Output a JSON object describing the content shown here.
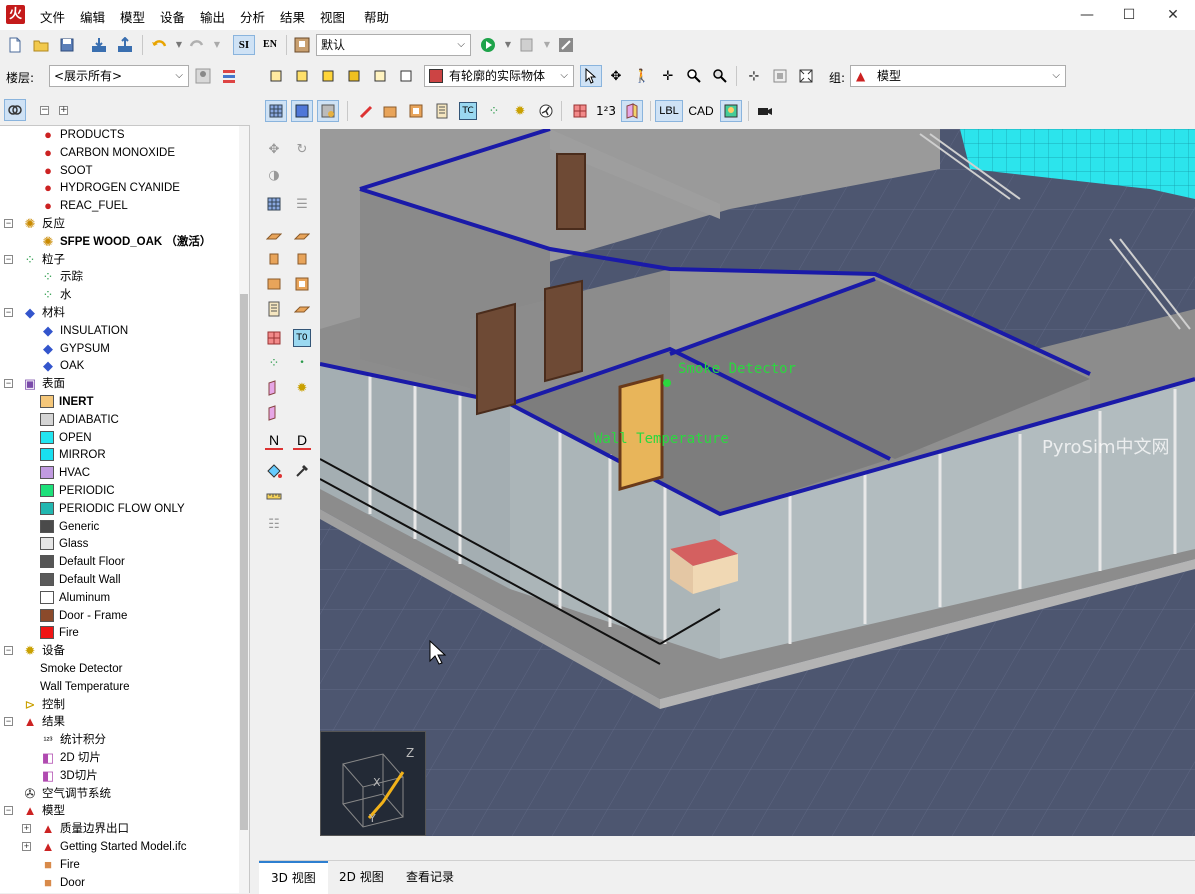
{
  "app": {
    "logo_glyph": "火",
    "accent": "#c41a1a"
  },
  "menu": [
    "文件",
    "编辑",
    "模型",
    "设备",
    "输出",
    "分析",
    "结果",
    "视图",
    "帮助"
  ],
  "window_controls": {
    "minimize": "—",
    "maximize": "☐",
    "close": "✕"
  },
  "toolbar1": {
    "units_si": "SI",
    "units_en": "EN",
    "view_combo": "默认"
  },
  "toolbar2": {
    "floor_label": "楼层:",
    "floor_combo": "<展示所有>",
    "filter_combo": "有轮廓的实际物体",
    "group_label": "组:",
    "group_combo": "模型"
  },
  "toolbar3": {
    "lbl_button": "LBL",
    "cad_button": "CAD"
  },
  "vstrip": {
    "n_button": "N",
    "d_button": "D"
  },
  "tree": {
    "rows": [
      {
        "label": "PRODUCTS",
        "indent": 2,
        "icon": "species",
        "bold": false
      },
      {
        "label": "CARBON MONOXIDE",
        "indent": 2,
        "icon": "species",
        "bold": false
      },
      {
        "label": "SOOT",
        "indent": 2,
        "icon": "species",
        "bold": false
      },
      {
        "label": "HYDROGEN CYANIDE",
        "indent": 2,
        "icon": "species",
        "bold": false
      },
      {
        "label": "REAC_FUEL",
        "indent": 2,
        "icon": "species",
        "bold": false
      },
      {
        "label": "反应",
        "indent": 1,
        "icon": "reaction",
        "expander": "−",
        "bold": false
      },
      {
        "label": "SFPE WOOD_OAK （激活）",
        "indent": 2,
        "icon": "reaction",
        "bold": true
      },
      {
        "label": "粒子",
        "indent": 1,
        "icon": "particle",
        "expander": "−",
        "bold": false
      },
      {
        "label": "示踪",
        "indent": 2,
        "icon": "particle",
        "bold": false
      },
      {
        "label": "水",
        "indent": 2,
        "icon": "particle",
        "bold": false
      },
      {
        "label": "材料",
        "indent": 1,
        "icon": "material",
        "expander": "−",
        "bold": false
      },
      {
        "label": "INSULATION",
        "indent": 2,
        "icon": "material",
        "bold": false
      },
      {
        "label": "GYPSUM",
        "indent": 2,
        "icon": "material",
        "bold": false
      },
      {
        "label": "OAK",
        "indent": 2,
        "icon": "material",
        "bold": false
      },
      {
        "label": "表面",
        "indent": 1,
        "icon": "surface",
        "expander": "−",
        "bold": false
      },
      {
        "label": "INERT",
        "indent": 2,
        "swatch": "#f5c77a",
        "bold": true
      },
      {
        "label": "ADIABATIC",
        "indent": 2,
        "swatch": "#d4d4d4",
        "bold": false
      },
      {
        "label": "OPEN",
        "indent": 2,
        "swatch": "#22e5f0",
        "bold": false
      },
      {
        "label": "MIRROR",
        "indent": 2,
        "swatch": "#19dff0",
        "bold": false
      },
      {
        "label": "HVAC",
        "indent": 2,
        "swatch": "#c09ae0",
        "bold": false
      },
      {
        "label": "PERIODIC",
        "indent": 2,
        "swatch": "#1de07a",
        "bold": false
      },
      {
        "label": "PERIODIC FLOW ONLY",
        "indent": 2,
        "swatch": "#22b7b0",
        "bold": false
      },
      {
        "label": "Generic",
        "indent": 2,
        "swatch": "#4a4a4a",
        "bold": false
      },
      {
        "label": "Glass",
        "indent": 2,
        "swatch": "#e6e6e6",
        "bold": false
      },
      {
        "label": "Default Floor",
        "indent": 2,
        "swatch": "#555555",
        "bold": false
      },
      {
        "label": "Default Wall",
        "indent": 2,
        "swatch": "#5a5a5a",
        "bold": false
      },
      {
        "label": "Aluminum",
        "indent": 2,
        "swatch": "#ffffff",
        "bold": false
      },
      {
        "label": "Door - Frame",
        "indent": 2,
        "swatch": "#8b4a2b",
        "bold": false
      },
      {
        "label": "Fire",
        "indent": 2,
        "swatch": "#f01414",
        "bold": false
      },
      {
        "label": "设备",
        "indent": 1,
        "icon": "device",
        "expander": "−",
        "bold": false
      },
      {
        "label": "Smoke Detector",
        "indent": 2,
        "icon": "none",
        "bold": false
      },
      {
        "label": "Wall Temperature",
        "indent": 2,
        "icon": "none",
        "bold": false
      },
      {
        "label": "控制",
        "indent": 1,
        "icon": "control",
        "bold": false
      },
      {
        "label": "结果",
        "indent": 1,
        "icon": "model",
        "expander": "−",
        "bold": false
      },
      {
        "label": "统计积分",
        "indent": 2,
        "icon": "stat",
        "bold": false
      },
      {
        "label": "2D 切片",
        "indent": 2,
        "icon": "slice",
        "bold": false
      },
      {
        "label": "3D切片",
        "indent": 2,
        "icon": "slice",
        "bold": false
      },
      {
        "label": "空气调节系统",
        "indent": 1,
        "icon": "hvac",
        "bold": false
      },
      {
        "label": "模型",
        "indent": 1,
        "icon": "model",
        "expander": "−",
        "bold": false
      },
      {
        "label": "质量边界出口",
        "indent": 2,
        "icon": "model",
        "expander": "+",
        "bold": false
      },
      {
        "label": "Getting Started Model.ifc",
        "indent": 2,
        "icon": "model",
        "expander": "+",
        "bold": false
      },
      {
        "label": "Fire",
        "indent": 2,
        "icon": "block",
        "bold": false
      },
      {
        "label": "Door",
        "indent": 2,
        "icon": "block",
        "bold": false
      }
    ]
  },
  "viewport": {
    "label_smoke": "Smoke Detector",
    "label_wall": "Wall Temperature",
    "watermark": "PyroSim中文网",
    "axis_z": "Z",
    "axis_x": "X",
    "axis_y": "Y"
  },
  "tabs": [
    "3D 视图",
    "2D 视图",
    "查看记录"
  ],
  "active_tab": "3D 视图"
}
